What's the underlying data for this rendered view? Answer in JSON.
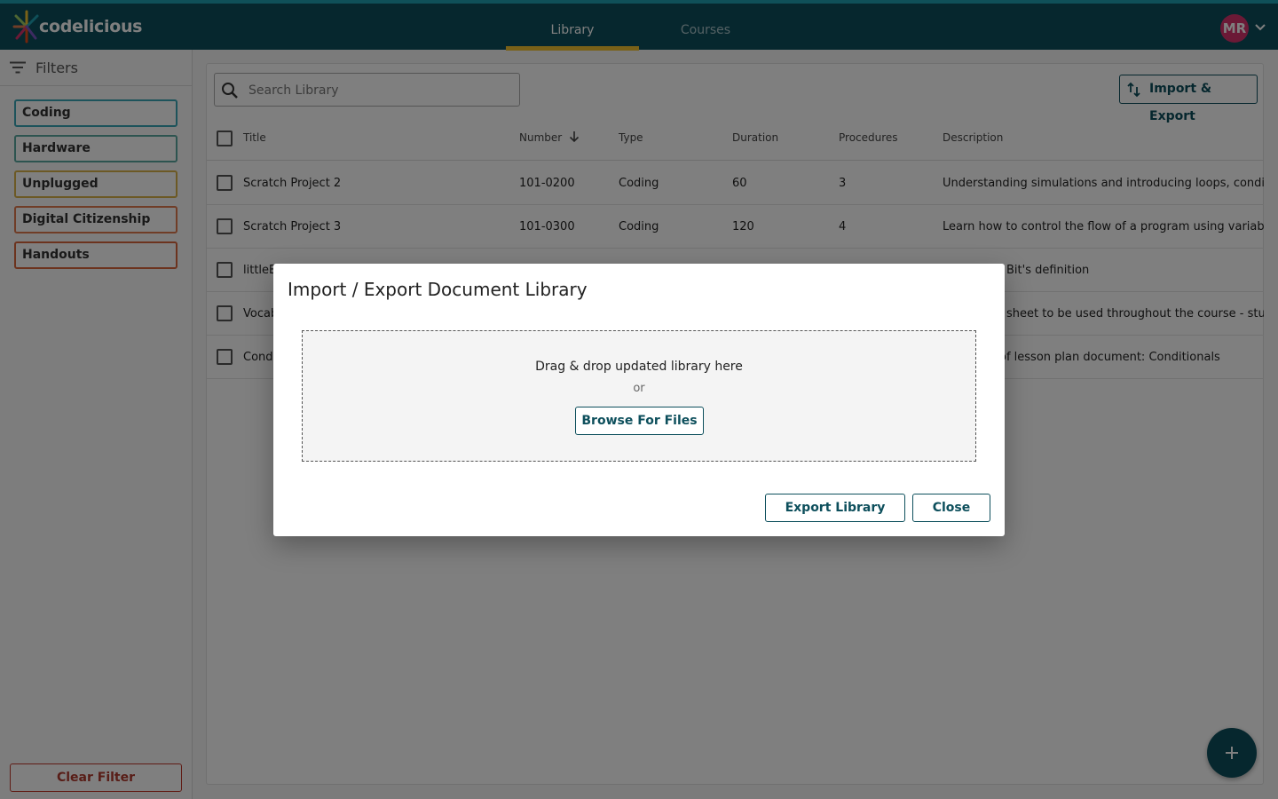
{
  "header": {
    "logo_text": "codelicious",
    "tabs": [
      {
        "label": "Library",
        "active": true
      },
      {
        "label": "Courses",
        "active": false
      }
    ],
    "avatar_initials": "MR",
    "colors": {
      "bar": "#0d4f5c",
      "accent_top": "#1ea1b2",
      "tab_underline": "#f2c230",
      "avatar": "#d6336c"
    }
  },
  "sidebar": {
    "filters_label": "Filters",
    "chips": [
      {
        "label": "Coding",
        "color": "#3aa6b6"
      },
      {
        "label": "Hardware",
        "color": "#5aa9a0"
      },
      {
        "label": "Unplugged",
        "color": "#d8b24a"
      },
      {
        "label": "Digital Citizenship",
        "color": "#e07a4f"
      },
      {
        "label": "Handouts",
        "color": "#d9673d"
      }
    ],
    "clear_filter_label": "Clear Filter"
  },
  "library": {
    "search_placeholder": "Search Library",
    "import_export_label": "Import & Export",
    "columns": [
      "Title",
      "Number",
      "Type",
      "Duration",
      "Procedures",
      "Description"
    ],
    "sort_column": "Number",
    "sort_direction": "descending",
    "rows": [
      {
        "title": "Scratch Project 2",
        "number": "101-0200",
        "type": "Coding",
        "duration": "60",
        "procedures": "3",
        "description": "Understanding simulations  and introducing loops, conditior"
      },
      {
        "title": "Scratch Project 3",
        "number": "101-0300",
        "type": "Coding",
        "duration": "120",
        "procedures": "4",
        "description": "Learn how to control the flow of a program using variables, f"
      },
      {
        "title": "littleB",
        "number": "",
        "type": "",
        "duration": "",
        "procedures": "",
        "description": "Bit's definition"
      },
      {
        "title": "Vocab",
        "number": "",
        "type": "",
        "duration": "",
        "procedures": "",
        "description": "sheet to be used throughout the course - studen"
      },
      {
        "title": "Condi",
        "number": "",
        "type": "",
        "duration": "",
        "procedures": "",
        "description": "of lesson plan document: Conditionals"
      }
    ]
  },
  "dialog": {
    "title": "Import / Export Document Library",
    "dropzone_text": "Drag & drop updated library here",
    "or_text": "or",
    "browse_label": "Browse For Files",
    "export_label": "Export Library",
    "close_label": "Close"
  },
  "fab": {
    "icon": "plus-icon"
  }
}
